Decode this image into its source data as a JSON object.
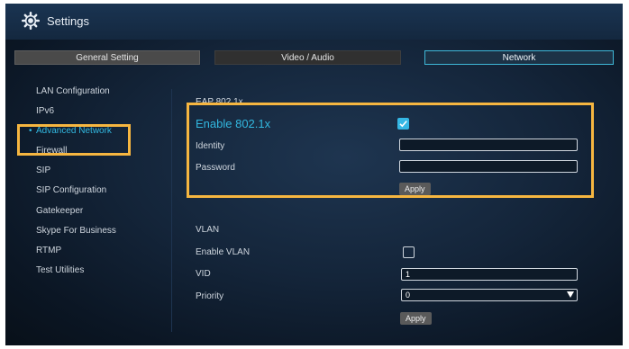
{
  "app": {
    "title": "Settings",
    "icon": "gear-icon"
  },
  "tabs": [
    {
      "label": "General Setting",
      "selected": false
    },
    {
      "label": "Video / Audio",
      "selected": false
    },
    {
      "label": "Network",
      "selected": true
    }
  ],
  "sidebar": {
    "items": [
      {
        "label": "LAN Configuration",
        "active": false
      },
      {
        "label": "IPv6",
        "active": false
      },
      {
        "label": "Advanced Network",
        "active": true
      },
      {
        "label": "Firewall",
        "active": false
      },
      {
        "label": "SIP",
        "active": false
      },
      {
        "label": "SIP Configuration",
        "active": false
      },
      {
        "label": "Gatekeeper",
        "active": false
      },
      {
        "label": "Skype For Business",
        "active": false
      },
      {
        "label": "RTMP",
        "active": false
      },
      {
        "label": "Test Utilities",
        "active": false
      }
    ],
    "bullet": "•"
  },
  "eap": {
    "section_title": "EAP 802.1x",
    "enable_label": "Enable 802.1x",
    "enable_checked": true,
    "identity_label": "Identity",
    "identity_value": "",
    "password_label": "Password",
    "password_value": "",
    "apply_label": "Apply"
  },
  "vlan": {
    "section_title": "VLAN",
    "enable_label": "Enable VLAN",
    "enable_checked": false,
    "vid_label": "VID",
    "vid_value": "1",
    "priority_label": "Priority",
    "priority_value": "0",
    "apply_label": "Apply"
  },
  "colors": {
    "accent": "#32b8e0",
    "highlight": "#f6b640",
    "background": "#14253a"
  }
}
